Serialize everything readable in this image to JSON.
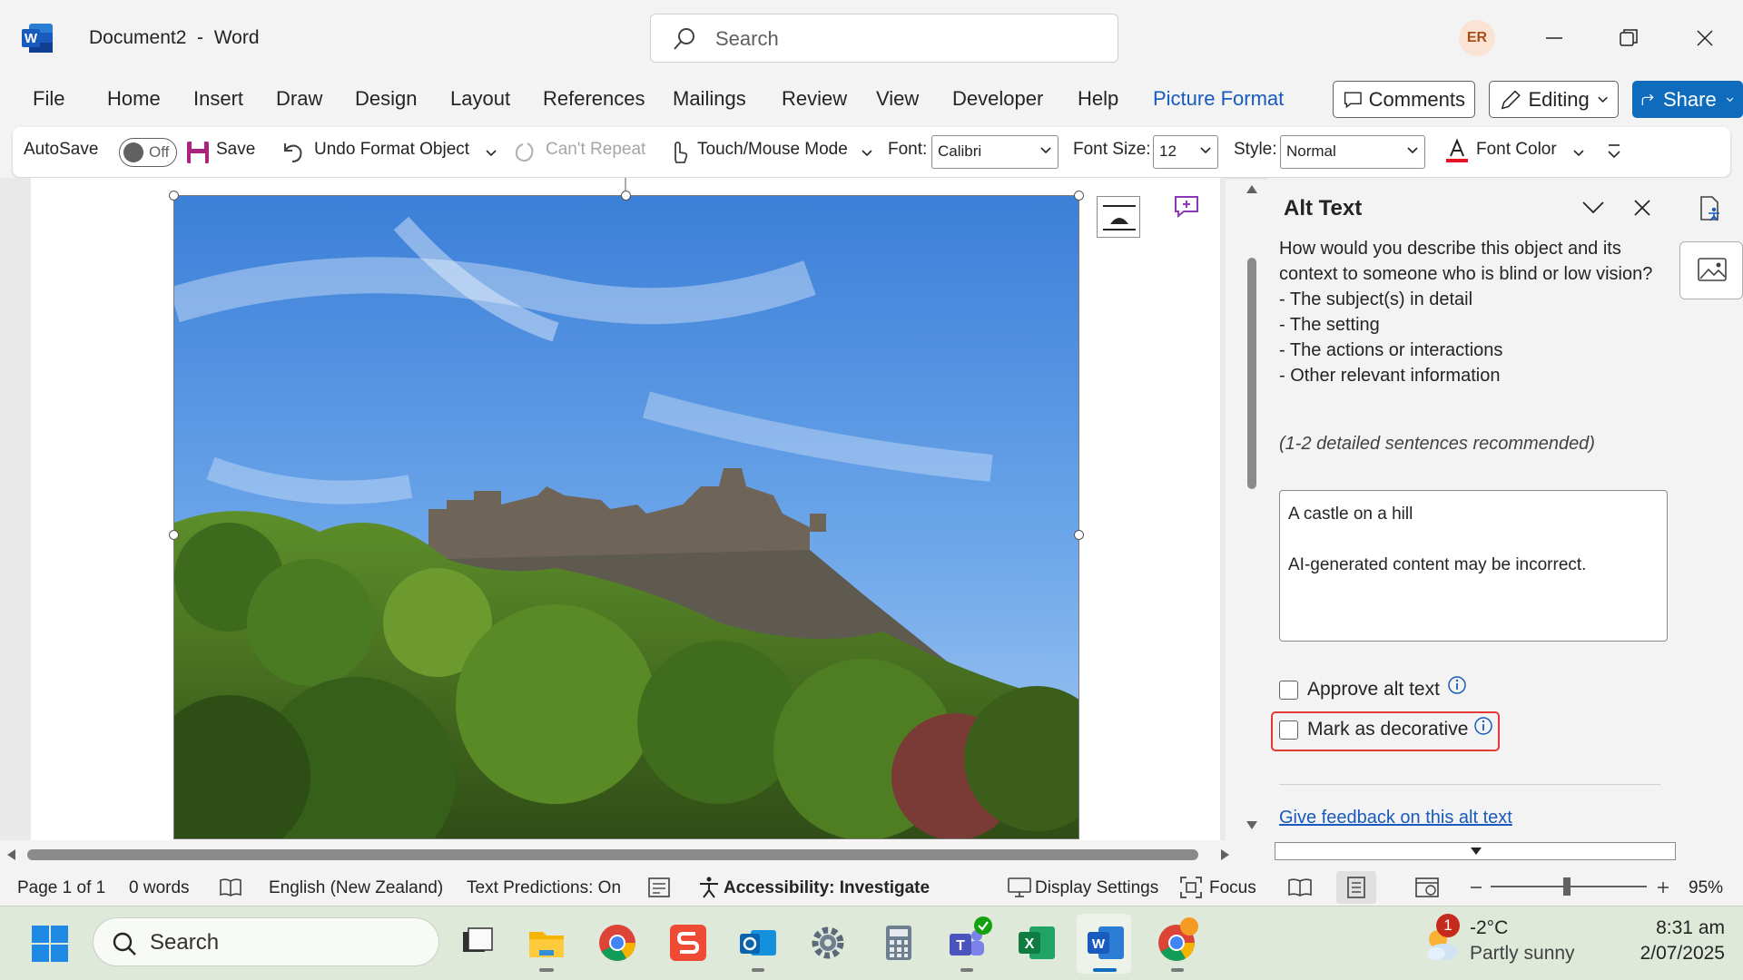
{
  "window": {
    "title": "Document2  -  Word",
    "app_icon": "word-icon",
    "search_placeholder": "Search",
    "user_initials": "ER"
  },
  "ribbon_tabs": [
    {
      "label": "File"
    },
    {
      "label": "Home"
    },
    {
      "label": "Insert"
    },
    {
      "label": "Draw"
    },
    {
      "label": "Design"
    },
    {
      "label": "Layout"
    },
    {
      "label": "References"
    },
    {
      "label": "Mailings"
    },
    {
      "label": "Review"
    },
    {
      "label": "View"
    },
    {
      "label": "Developer"
    },
    {
      "label": "Help"
    },
    {
      "label": "Picture Format",
      "active": true
    }
  ],
  "ribbon_actions": {
    "comments": "Comments",
    "editing": "Editing",
    "share": "Share"
  },
  "toolbar": {
    "autosave_label": "AutoSave",
    "autosave_state": "Off",
    "save": "Save",
    "undo": "Undo Format Object",
    "repeat": "Can't Repeat",
    "touch_mode": "Touch/Mouse Mode",
    "font_label": "Font:",
    "font_value": "Calibri",
    "font_size_label": "Font Size:",
    "font_size_value": "12",
    "style_label": "Style:",
    "style_value": "Normal",
    "font_color": "Font Color",
    "font_color_hex": "#e81123"
  },
  "alt_text_pane": {
    "title": "Alt Text",
    "prompt_lines": [
      "How would you describe this object and its context to someone who is blind or low vision?",
      "- The subject(s) in detail",
      "- The setting",
      "- The actions or interactions",
      "- Other relevant information"
    ],
    "hint": "(1-2 detailed sentences recommended)",
    "text_line1": "A castle on a hill",
    "text_line2": "AI-generated content may be incorrect.",
    "approve_label": "Approve alt text",
    "decorative_label": "Mark as decorative",
    "feedback_link": "Give feedback on this alt text",
    "highlight_color": "#e53935"
  },
  "statusbar": {
    "page": "Page 1 of 1",
    "words": "0 words",
    "language": "English (New Zealand)",
    "text_predictions": "Text Predictions: On",
    "accessibility": "Accessibility: Investigate",
    "display_settings": "Display Settings",
    "focus": "Focus",
    "zoom": "95%"
  },
  "taskbar": {
    "search": "Search",
    "weather_temp": "-2°C",
    "weather_desc": "Partly sunny",
    "weather_badge": "1",
    "time": "8:31 am",
    "date": "2/07/2025"
  }
}
